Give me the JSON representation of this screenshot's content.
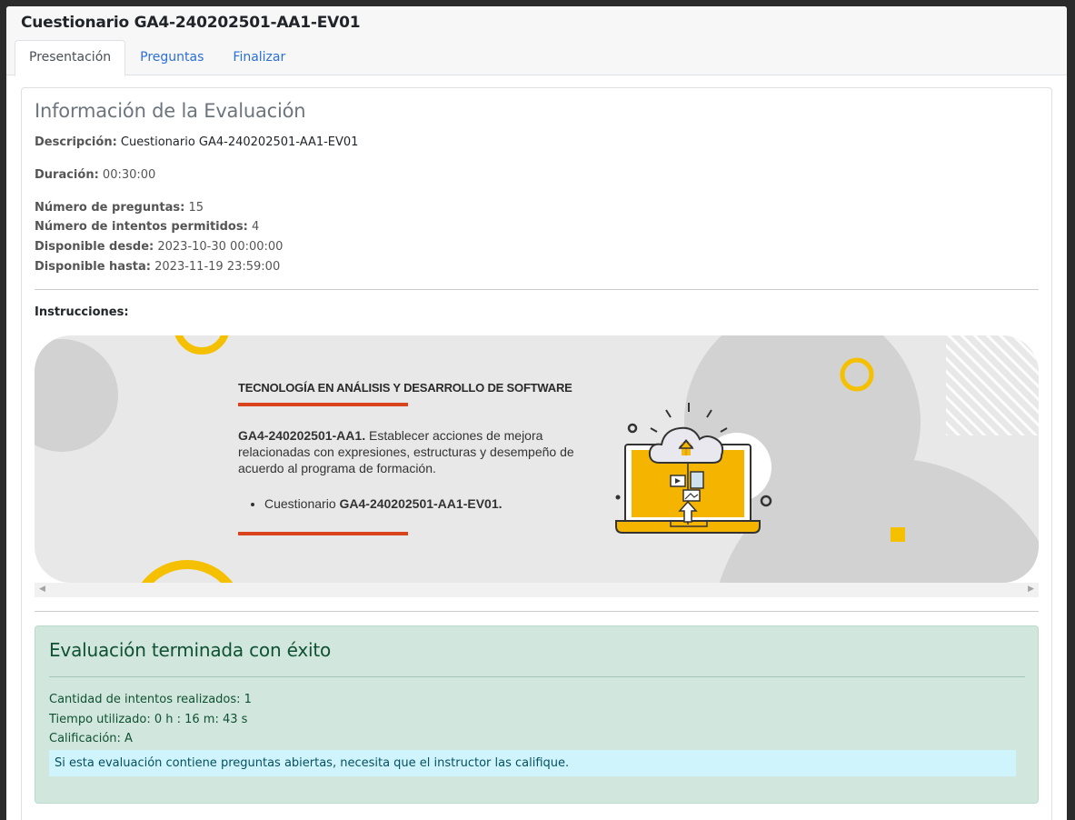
{
  "window": {
    "title": "Cuestionario GA4-240202501-AA1-EV01"
  },
  "tabs": [
    {
      "label": "Presentación",
      "active": true
    },
    {
      "label": "Preguntas",
      "active": false
    },
    {
      "label": "Finalizar",
      "active": false
    }
  ],
  "info": {
    "title": "Información de la Evaluación",
    "descripcion_label": "Descripción:",
    "descripcion_value": "Cuestionario GA4-240202501-AA1-EV01",
    "duracion_label": "Duración:",
    "duracion_value": "00:30:00",
    "preguntas_label": "Número de preguntas:",
    "preguntas_value": "15",
    "intentos_label": "Número de intentos permitidos:",
    "intentos_value": "4",
    "desde_label": "Disponible desde:",
    "desde_value": "2023-10-30 00:00:00",
    "hasta_label": "Disponible hasta:",
    "hasta_value": "2023-11-19 23:59:00"
  },
  "instrucciones_label": "Instrucciones:",
  "banner": {
    "heading": "TECNOLOGÍA EN ANÁLISIS Y DESARROLLO DE SOFTWARE",
    "code_bold": "GA4-240202501-AA1.",
    "text": " Establecer acciones de mejora relacionadas con expresiones, estructuras y desempeño de acuerdo al programa de formación.",
    "list_prefix": "Cuestionario ",
    "list_bold": "GA4-240202501-AA1-EV01."
  },
  "result": {
    "title": "Evaluación terminada con éxito",
    "intentos": "Cantidad de intentos realizados: 1",
    "tiempo": "Tiempo utilizado: 0 h : 16 m: 43 s",
    "calificacion": "Calificación: A",
    "note": "Si esta evaluación contiene preguntas abiertas, necesita que el instructor las califique."
  },
  "colors": {
    "accent_blue": "#2c6fd6",
    "success_bg": "#d1e7dd",
    "success_text": "#0f5132",
    "banner_yellow": "#f5c000",
    "banner_red": "#d9441d"
  }
}
